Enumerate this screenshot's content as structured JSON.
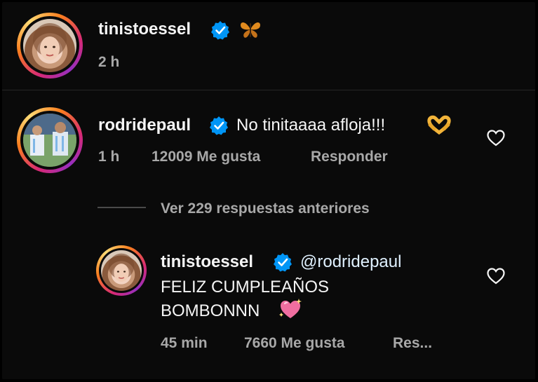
{
  "post": {
    "username": "tinistoessel",
    "emoji": "🦋",
    "time": "2 h"
  },
  "comment": {
    "username": "rodridepaul",
    "text": "No tinitaaaa afloja!!!",
    "emoji": "🫶",
    "time": "1 h",
    "likes": "12009 Me gusta",
    "reply_label": "Responder"
  },
  "replies_toggle": {
    "label": "Ver 229 respuestas anteriores"
  },
  "reply": {
    "username": "tinistoessel",
    "mention": "@rodridepaul",
    "line1": "FELIZ CUMPLEAÑOS",
    "line2": "BOMBONNN",
    "emoji": "💖",
    "time": "45 min",
    "likes": "7660 Me gusta",
    "reply_label": "Res..."
  },
  "colors": {
    "background": "#0a0a0a",
    "verified": "#0095f6",
    "meta_text": "#a8a8a8",
    "primary_text": "#f5f5f5"
  }
}
